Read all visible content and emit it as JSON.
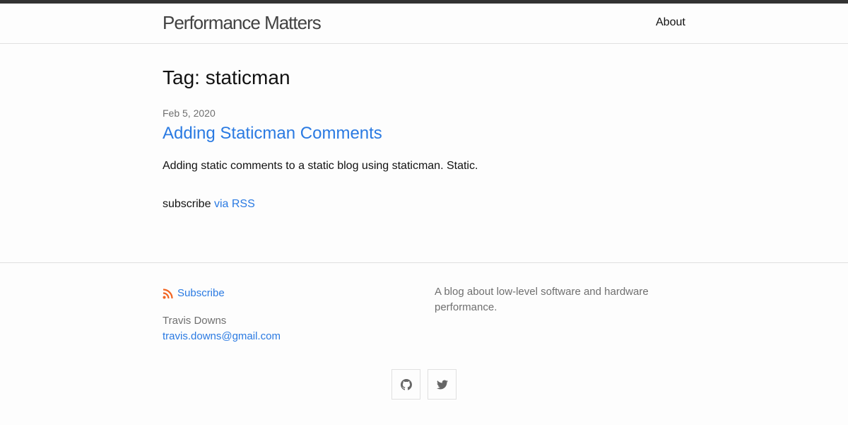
{
  "header": {
    "site_title": "Performance Matters",
    "nav": {
      "about": "About"
    }
  },
  "main": {
    "page_heading": "Tag: staticman",
    "posts": [
      {
        "date": "Feb 5, 2020",
        "title": "Adding Staticman Comments",
        "excerpt": "Adding static comments to a static blog using staticman. Static."
      }
    ],
    "rss": {
      "prefix": "subscribe",
      "link": "via RSS"
    }
  },
  "footer": {
    "subscribe_label": "Subscribe",
    "author_name": "Travis Downs",
    "author_email": "travis.downs@gmail.com",
    "description": "A blog about low-level software and hardware performance.",
    "social": [
      {
        "icon": "github-icon"
      },
      {
        "icon": "twitter-icon"
      }
    ]
  },
  "colors": {
    "link": "#2a7ae2",
    "rss_orange": "#f26522",
    "topbar": "#333333",
    "muted_text": "#6f6f6f"
  }
}
